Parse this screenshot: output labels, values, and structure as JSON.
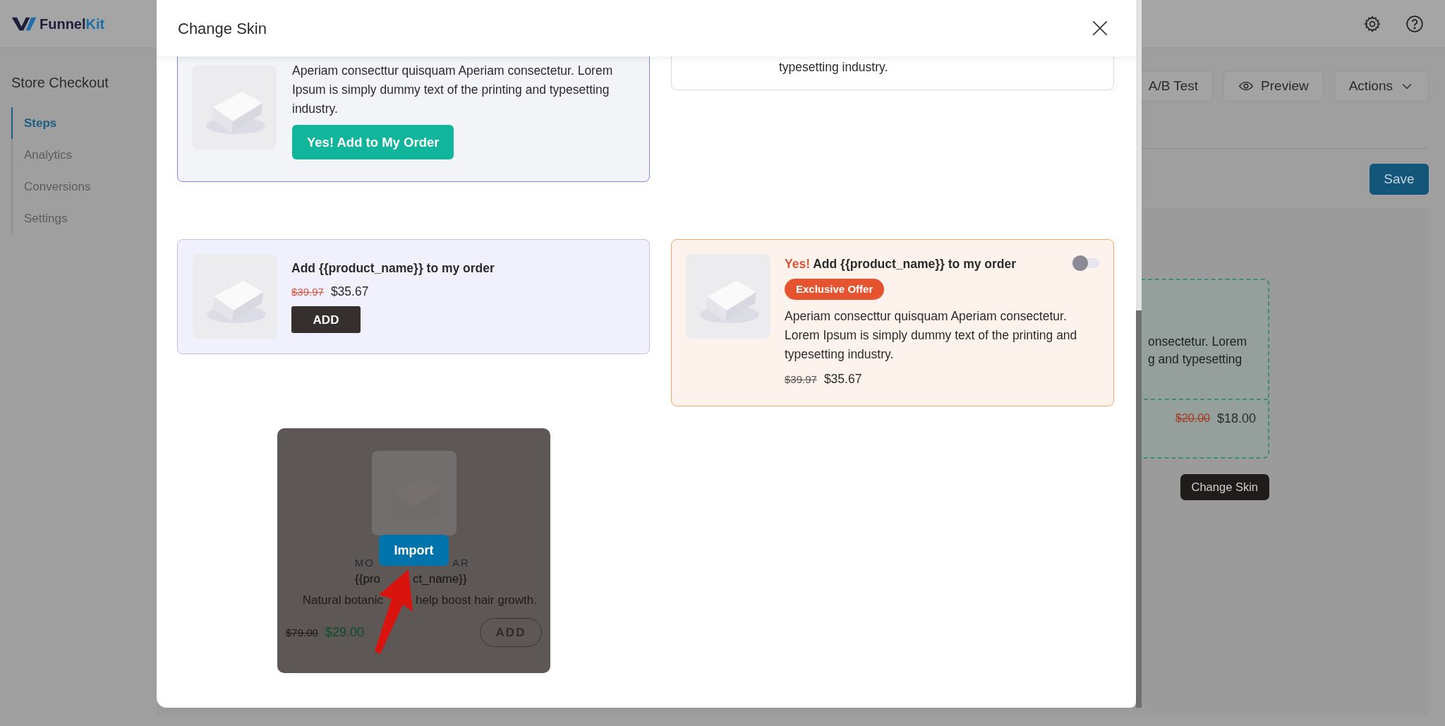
{
  "app": {
    "logo": [
      "Funnel",
      "Kit"
    ]
  },
  "sidebar": {
    "title": "Store Checkout",
    "items": [
      {
        "label": "Steps",
        "selected": true
      },
      {
        "label": "Analytics",
        "selected": false
      },
      {
        "label": "Conversions",
        "selected": false
      },
      {
        "label": "Settings",
        "selected": false
      }
    ]
  },
  "toolbar": {
    "buttons": [
      {
        "label": "A/B Test",
        "kind": "plain"
      },
      {
        "label": "Preview",
        "kind": "eye"
      },
      {
        "label": "Actions",
        "kind": "dropdown"
      }
    ],
    "save": "Save"
  },
  "preview": {
    "text_lines": [
      "onsectetur. Lorem",
      "g and typesetting"
    ],
    "old_price": "$20.00",
    "price": "$18.00",
    "button": "Change Skin"
  },
  "modal": {
    "title": "Change Skin",
    "skins": [
      {
        "kind": "cta",
        "description": "Aperiam consecttur quisquam Aperiam consectetur. Lorem Ipsum is simply dummy text of the printing and typesetting industry.",
        "button": "Yes! Add to My Order"
      },
      {
        "kind": "partial",
        "description": "typesetting industry."
      },
      {
        "kind": "compact",
        "title": "Add {{product_name}} to my order",
        "old_price": "$39.97",
        "price": "$35.67",
        "button": "ADD"
      },
      {
        "kind": "toggle",
        "accent": "Yes!",
        "title": "Add {{product_name}} to my order",
        "on": false,
        "badge": "Exclusive Offer",
        "description": "Aperiam consecttur quisquam Aperiam consectetur. Lorem Ipsum is simply dummy text of the printing and typesetting industry.",
        "old_price": "$39.97",
        "price": "$35.67"
      },
      {
        "kind": "hover",
        "category": [
          "MO",
          "AR"
        ],
        "name": [
          "{{pro",
          "ct_name}}"
        ],
        "description": [
          "Natural botanic",
          "help boost hair growth."
        ],
        "old_price": "$79.00",
        "price": "$29.00",
        "button": "ADD",
        "action": "Import"
      }
    ]
  }
}
